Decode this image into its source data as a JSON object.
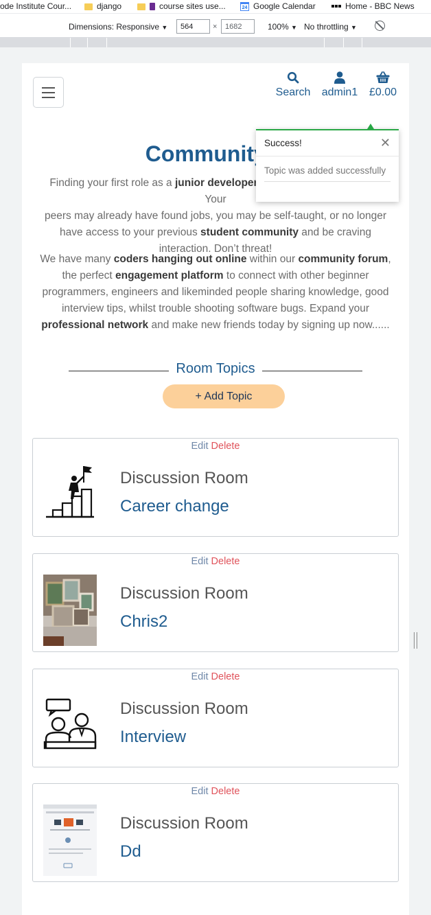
{
  "bookmarks": [
    {
      "label": "ode Institute Cour...",
      "icon": "folder-icon"
    },
    {
      "label": "django",
      "icon": "folder-icon"
    },
    {
      "label": "course sites use...",
      "icon": "book-icon"
    },
    {
      "label": "Google Calendar",
      "icon": "calendar-icon",
      "icon_text": "24"
    },
    {
      "label": "Home - BBC News",
      "icon": "bbc-icon"
    }
  ],
  "devtools": {
    "dimensions_label": "Dimensions: Responsive",
    "width": "564",
    "height": "1682",
    "times": "×",
    "zoom": "100%",
    "throttling": "No throttling",
    "dropdown_glyph": "▼"
  },
  "nav": {
    "search_label": "Search",
    "user_label": "admin1",
    "bag_label": "£0.00"
  },
  "hero": {
    "title": "Community F",
    "para1_parts": [
      {
        "t": "Finding your first role as a "
      },
      {
        "t": "junior developer",
        "b": true
      },
      {
        "t": " can be a lonely process... Your"
      }
    ],
    "para1_line2": "peers may already have found jobs, you may be self-taught, or no longer",
    "para1_line3_parts": [
      {
        "t": "have access to your previous "
      },
      {
        "t": "student community",
        "b": true
      },
      {
        "t": " and be craving"
      }
    ],
    "para1_line4": "interaction. Don’t threat!",
    "para2_lines": [
      [
        {
          "t": "We have many "
        },
        {
          "t": "coders hanging out online",
          "b": true
        },
        {
          "t": " within our "
        },
        {
          "t": "community forum",
          "b": true
        },
        {
          "t": ","
        }
      ],
      [
        {
          "t": "the perfect "
        },
        {
          "t": "engagement platform",
          "b": true
        },
        {
          "t": " to connect with other beginner"
        }
      ],
      [
        {
          "t": "programmers, engineers and likeminded people sharing knowledge, good"
        }
      ],
      [
        {
          "t": "interview tips, whilst trouble shooting software bugs. Expand your"
        }
      ],
      [
        {
          "t": "professional network",
          "b": true
        },
        {
          "t": " and make new friends today by signing up now......"
        }
      ]
    ]
  },
  "topics": {
    "title": "Room Topics",
    "add_button": "+ Add Topic",
    "edit_label": "Edit",
    "delete_label": "Delete",
    "room_label": "Discussion Room",
    "items": [
      {
        "name": "Career change",
        "thumb": "career-climb-icon"
      },
      {
        "name": "Chris2",
        "thumb": "photo-frames-image"
      },
      {
        "name": "Interview",
        "thumb": "interview-people-icon"
      },
      {
        "name": "Dd",
        "thumb": "screenshot-thumbnail-image"
      }
    ]
  },
  "toast": {
    "title": "Success!",
    "close_glyph": "✕",
    "message": "Topic was added successfully"
  },
  "colors": {
    "brand_blue": "#1f5c8f",
    "delete_red": "#e0535b",
    "add_button_bg": "#fcd09a",
    "success_green": "#28a745"
  }
}
